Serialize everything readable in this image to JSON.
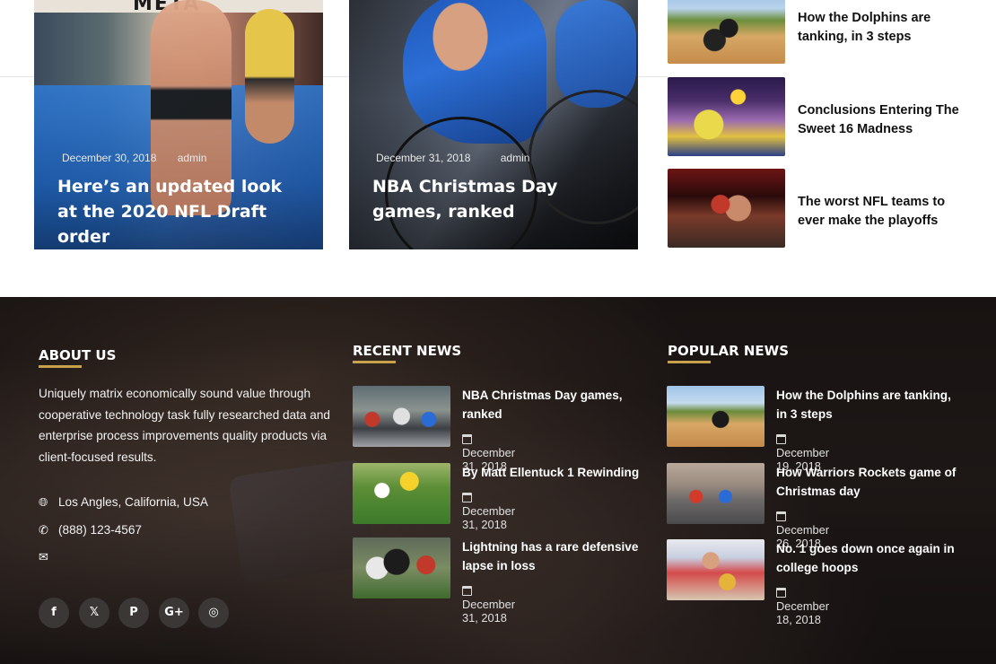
{
  "featured": [
    {
      "date": "December 30, 2018",
      "author": "admin",
      "title": "Here’s an updated look at the 2020 NFL Draft order",
      "banner_text": "META"
    },
    {
      "date": "December 31, 2018",
      "author": "admin",
      "title": "NBA Christmas Day games, ranked"
    }
  ],
  "side_list": [
    {
      "title": "How the Dolphins are tanking, in 3 steps",
      "image": "motocross"
    },
    {
      "title": "Conclusions Entering The Sweet 16 Madness",
      "image": "volleyball"
    },
    {
      "title": "The worst NFL teams to ever make the playoffs",
      "image": "boxing"
    }
  ],
  "footer": {
    "about": {
      "heading": "ABOUT US",
      "text": "Uniquely matrix economically sound value through cooperative technology task fully researched data and enterprise process improvements quality  products via client-focused results.",
      "location": "Los Angles, California, USA",
      "phone": "(888) 123-4567",
      "email": "",
      "icons": {
        "location": "globe-icon",
        "phone": "phone-icon",
        "email": "envelope-icon"
      },
      "socials": [
        {
          "name": "facebook-icon",
          "glyph": "f"
        },
        {
          "name": "x-icon",
          "glyph": "𝕏"
        },
        {
          "name": "pinterest-icon",
          "glyph": "P"
        },
        {
          "name": "google-plus-icon",
          "glyph": "G+"
        },
        {
          "name": "instagram-icon",
          "glyph": "◎"
        }
      ]
    },
    "recent": {
      "heading": "RECENT NEWS",
      "items": [
        {
          "title": "NBA Christmas Day games, ranked",
          "date": "December 31, 2018",
          "image": "cycling"
        },
        {
          "title": "By Matt Ellentuck 1 Rewinding",
          "date": "December 31, 2018",
          "image": "soccer"
        },
        {
          "title": "Lightning has a rare defensive lapse in loss",
          "date": "December 31, 2018",
          "image": "football"
        }
      ]
    },
    "popular": {
      "heading": "POPULAR NEWS",
      "items": [
        {
          "title": "How the Dolphins are tanking, in 3 steps",
          "date": "December 19, 2018",
          "image": "motocross"
        },
        {
          "title": "How Warriors Rockets game of Christmas day",
          "date": "December 26, 2018",
          "image": "cycling-race"
        },
        {
          "title": "No. 1 goes down once again in college hoops",
          "date": "December 18, 2018",
          "image": "volleyball"
        }
      ]
    },
    "accent_color": "#c8a24a"
  }
}
